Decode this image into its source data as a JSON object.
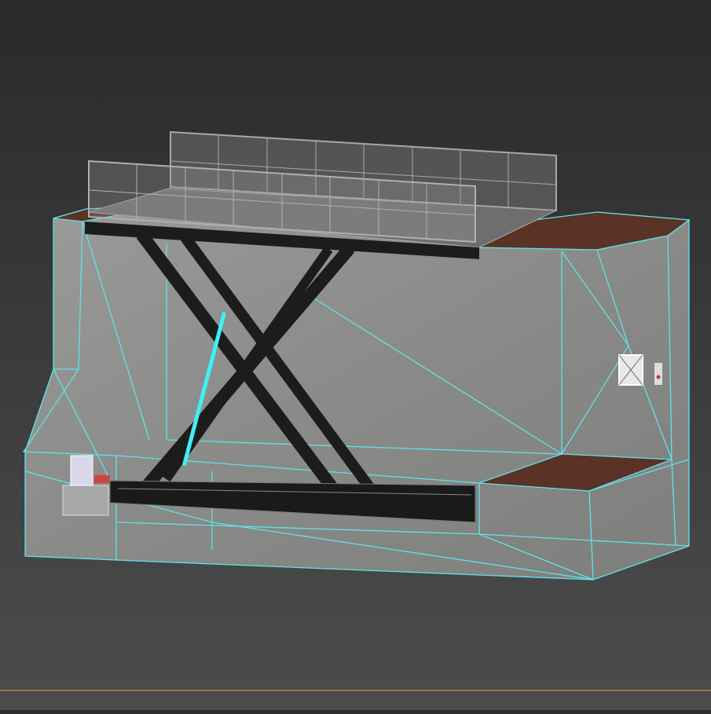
{
  "viewport": {
    "background_top": "#2a2a2a",
    "background_bottom": "#4c4c4c",
    "wire_color": "#5fe3ea",
    "concrete_color": "#8c8c8a",
    "floor_color": "#5a3226",
    "steel_color": "#1c1c1c",
    "railing_color": "#a8a8a8",
    "timeline_line_color": "#8c7a3c"
  }
}
